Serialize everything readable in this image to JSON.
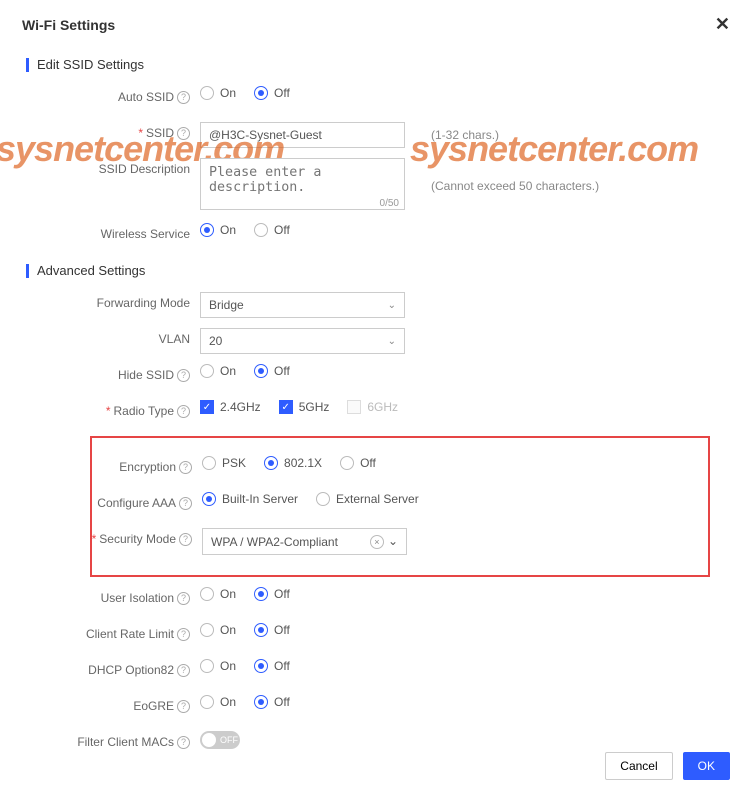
{
  "title": "Wi-Fi Settings",
  "sections": {
    "edit": "Edit SSID Settings",
    "advanced": "Advanced Settings"
  },
  "labels": {
    "autoSsid": "Auto SSID",
    "ssid": "SSID",
    "ssidDesc": "SSID Description",
    "wireless": "Wireless Service",
    "fwdMode": "Forwarding Mode",
    "vlan": "VLAN",
    "hideSsid": "Hide SSID",
    "radio": "Radio Type",
    "encryption": "Encryption",
    "configAaa": "Configure AAA",
    "secMode": "Security Mode",
    "userIso": "User Isolation",
    "rateLimit": "Client Rate Limit",
    "dhcp82": "DHCP Option82",
    "eogre": "EoGRE",
    "filterMac": "Filter Client MACs"
  },
  "options": {
    "on": "On",
    "off": "Off",
    "psk": "PSK",
    "dot1x": "802.1X",
    "builtIn": "Built-In Server",
    "external": "External Server",
    "g24": "2.4GHz",
    "g5": "5GHz",
    "g6": "6GHz",
    "toggleOff": "OFF"
  },
  "values": {
    "ssid": "@H3C-Sysnet-Guest",
    "descPlaceholder": "Please enter a description.",
    "descCounter": "0/50",
    "ssidHint": "(1-32 chars.)",
    "descHint": "(Cannot exceed 50 characters.)",
    "fwdMode": "Bridge",
    "vlan": "20",
    "secMode": "WPA / WPA2-Compliant"
  },
  "buttons": {
    "cancel": "Cancel",
    "ok": "OK"
  },
  "watermark": "sysnetcenter.com"
}
